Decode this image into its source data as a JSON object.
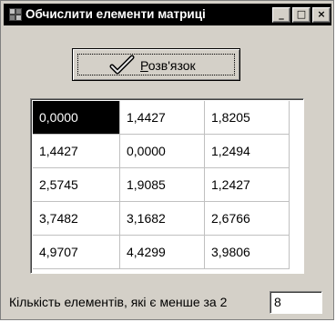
{
  "window": {
    "title": "Обчислити елементи матриці",
    "controls": {
      "minimize": "_",
      "maximize": "□",
      "close": "×"
    }
  },
  "solve_button": {
    "label_mnemonic": "Р",
    "label_rest": "озв'язок",
    "icon": "checkmark-icon"
  },
  "matrix": {
    "rows": [
      [
        "0,0000",
        "1,4427",
        "1,8205"
      ],
      [
        "1,4427",
        "0,0000",
        "1,2494"
      ],
      [
        "2,5745",
        "1,9085",
        "1,2427"
      ],
      [
        "3,7482",
        "3,1682",
        "2,6766"
      ],
      [
        "4,9707",
        "4,4299",
        "3,9806"
      ]
    ],
    "selected_cell": [
      0,
      0
    ]
  },
  "count": {
    "label": "Кількість елементів, які є менше за 2",
    "value": "8"
  },
  "colors": {
    "face": "#d4d0c8",
    "title_bar": "#000000",
    "selection": "#000000"
  }
}
